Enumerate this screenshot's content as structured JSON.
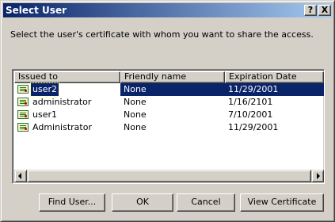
{
  "window": {
    "title": "Select User",
    "help_glyph": "?",
    "close_glyph": "X"
  },
  "prompt": "Select the user's certificate with whom you want to share the access.",
  "table": {
    "columns": [
      "Issued to",
      "Friendly name",
      "Expiration Date"
    ],
    "rows": [
      {
        "issued_to": "user2",
        "friendly_name": "None",
        "expiration": "11/29/2001",
        "selected": true
      },
      {
        "issued_to": "administrator",
        "friendly_name": "None",
        "expiration": "1/16/2101",
        "selected": false
      },
      {
        "issued_to": "user1",
        "friendly_name": "None",
        "expiration": "7/10/2001",
        "selected": false
      },
      {
        "issued_to": "Administrator",
        "friendly_name": "None",
        "expiration": "11/29/2001",
        "selected": false
      }
    ]
  },
  "buttons": {
    "find_user": "Find User...",
    "ok": "OK",
    "cancel": "Cancel",
    "view_certificate": "View Certificate"
  },
  "colors": {
    "titlebar_start": "#0a246a",
    "titlebar_end": "#a6caf0",
    "selection": "#0a246a",
    "face": "#d4d0c8"
  },
  "icons": {
    "row_icon": "certificate-icon"
  }
}
